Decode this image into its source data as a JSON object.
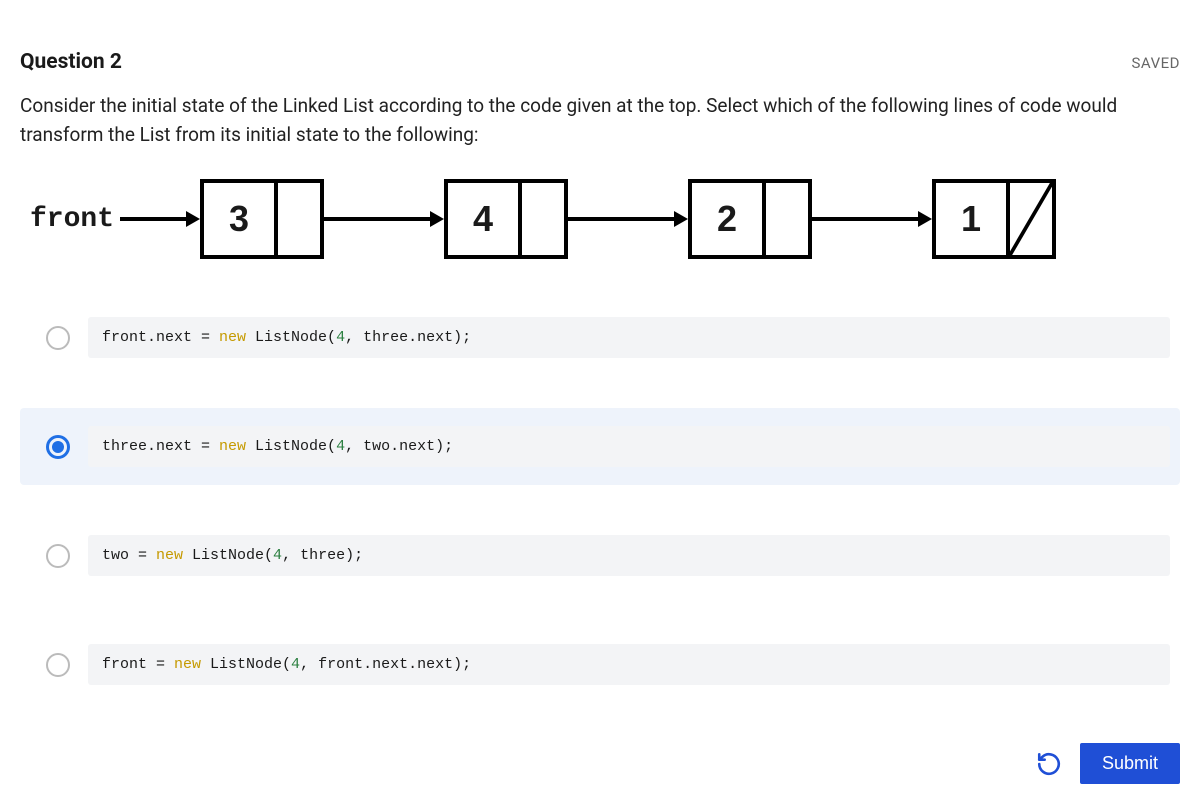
{
  "header": {
    "title": "Question 2",
    "status": "SAVED"
  },
  "prompt": "Consider the initial state of the Linked List according to the code given at the top. Select which of the following lines of code would transform the List from its initial state to the following:",
  "diagram": {
    "front_label": "front",
    "nodes": [
      "3",
      "4",
      "2",
      "1"
    ]
  },
  "options": [
    {
      "selected": false,
      "tokens": [
        {
          "t": "front.next = ",
          "c": ""
        },
        {
          "t": "new",
          "c": "kw"
        },
        {
          "t": " ListNode(",
          "c": ""
        },
        {
          "t": "4",
          "c": "num"
        },
        {
          "t": ", three.next);",
          "c": ""
        }
      ]
    },
    {
      "selected": true,
      "tokens": [
        {
          "t": "three.next = ",
          "c": ""
        },
        {
          "t": "new",
          "c": "kw"
        },
        {
          "t": " ListNode(",
          "c": ""
        },
        {
          "t": "4",
          "c": "num"
        },
        {
          "t": ", two.next);",
          "c": ""
        }
      ]
    },
    {
      "selected": false,
      "tokens": [
        {
          "t": "two = ",
          "c": ""
        },
        {
          "t": "new",
          "c": "kw"
        },
        {
          "t": " ListNode(",
          "c": ""
        },
        {
          "t": "4",
          "c": "num"
        },
        {
          "t": ", three);",
          "c": ""
        }
      ]
    },
    {
      "selected": false,
      "tokens": [
        {
          "t": "front = ",
          "c": ""
        },
        {
          "t": "new",
          "c": "kw"
        },
        {
          "t": " ListNode(",
          "c": ""
        },
        {
          "t": "4",
          "c": "num"
        },
        {
          "t": ", front.next.next);",
          "c": ""
        }
      ]
    }
  ],
  "footer": {
    "submit_label": "Submit"
  }
}
